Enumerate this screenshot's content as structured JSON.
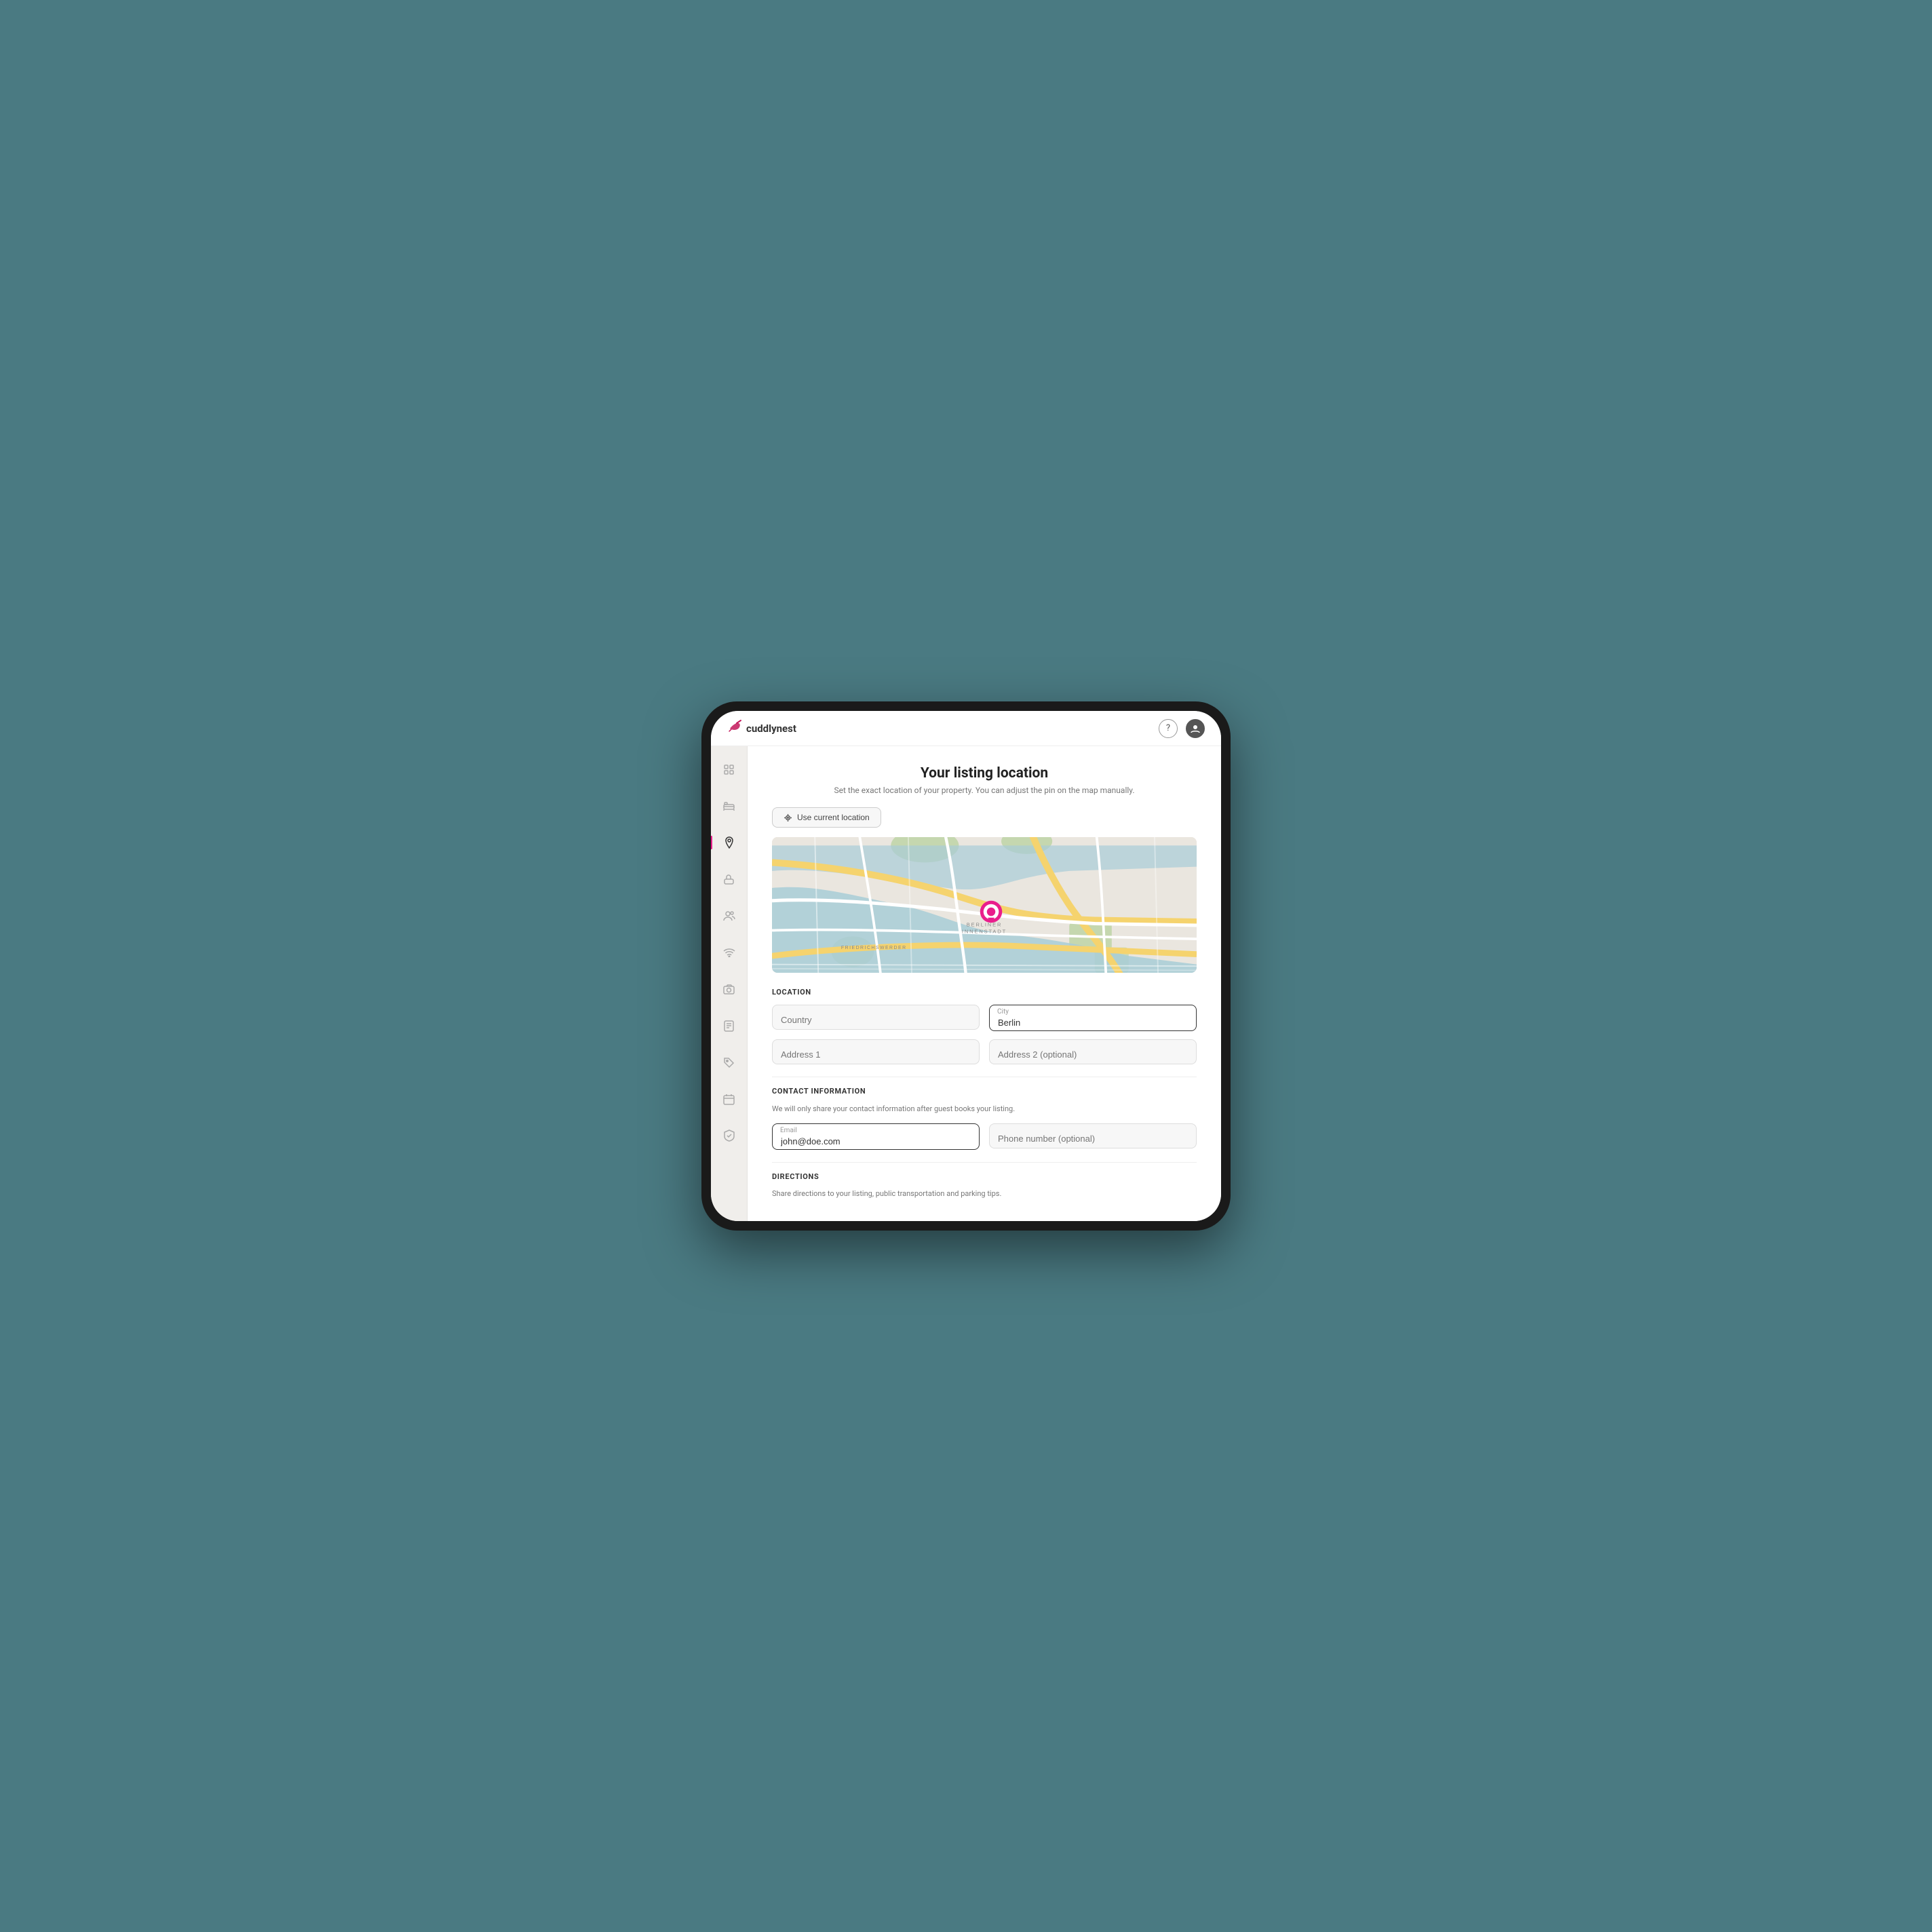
{
  "app": {
    "logo_text_light": "cuddly",
    "logo_text_bold": "nest",
    "logo_icon": "🐦"
  },
  "topbar": {
    "help_label": "?",
    "account_label": "👤"
  },
  "sidebar": {
    "items": [
      {
        "id": "home",
        "icon": "⊞",
        "active": false
      },
      {
        "id": "bed",
        "icon": "🛏",
        "active": false
      },
      {
        "id": "location",
        "icon": "📍",
        "active": true
      },
      {
        "id": "amenities",
        "icon": "🛁",
        "active": false
      },
      {
        "id": "guests",
        "icon": "👥",
        "active": false
      },
      {
        "id": "wifi",
        "icon": "📶",
        "active": false
      },
      {
        "id": "photos",
        "icon": "🖼",
        "active": false
      },
      {
        "id": "description",
        "icon": "📄",
        "active": false
      },
      {
        "id": "tags",
        "icon": "🏷",
        "active": false
      },
      {
        "id": "calendar",
        "icon": "📅",
        "active": false
      },
      {
        "id": "rules",
        "icon": "⚖",
        "active": false
      }
    ]
  },
  "page": {
    "title": "Your listing location",
    "subtitle": "Set the exact location of your property. You can adjust the pin on the map manually."
  },
  "use_location_btn": "Use current location",
  "location_section": {
    "label": "LOCATION",
    "country_placeholder": "Country",
    "city_label": "City",
    "city_value": "Berlin",
    "address1_placeholder": "Address 1",
    "address2_placeholder": "Address 2 (optional)"
  },
  "contact_section": {
    "label": "CONTACT INFORMATION",
    "subtitle": "We will only share your contact information after guest books your listing.",
    "email_label": "Email",
    "email_value": "john@doe.com",
    "phone_placeholder": "Phone number (optional)"
  },
  "directions_section": {
    "label": "DIRECTIONS",
    "subtitle": "Share directions to your listing, public transportation and parking tips."
  },
  "colors": {
    "accent": "#e91e8c",
    "map_water": "#a8ccd7",
    "map_road_yellow": "#f5d36e",
    "map_road_white": "#ffffff",
    "map_green": "#b5d09a",
    "map_base": "#eae6df"
  }
}
